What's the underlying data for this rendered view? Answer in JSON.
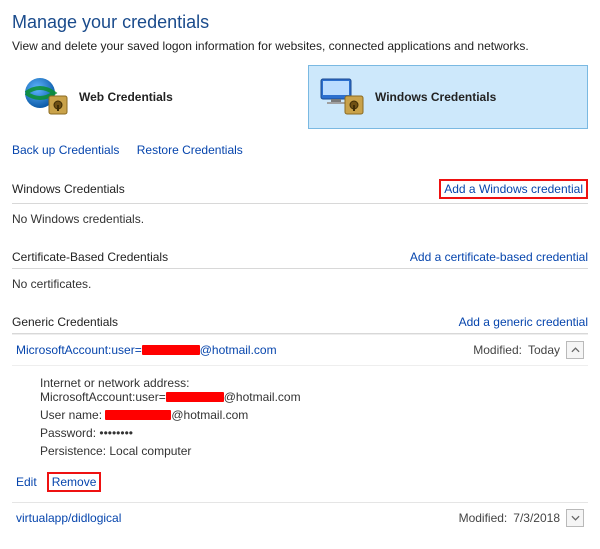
{
  "header": {
    "title": "Manage your credentials",
    "subtitle": "View and delete your saved logon information for websites, connected applications and networks."
  },
  "tiles": {
    "web": {
      "label": "Web Credentials"
    },
    "windows": {
      "label": "Windows Credentials"
    }
  },
  "link_bar": {
    "backup": "Back up Credentials",
    "restore": "Restore Credentials"
  },
  "sections": {
    "windows": {
      "title": "Windows Credentials",
      "add_label": "Add a Windows credential",
      "empty": "No Windows credentials."
    },
    "cert": {
      "title": "Certificate-Based Credentials",
      "add_label": "Add a certificate-based credential",
      "empty": "No certificates."
    },
    "generic": {
      "title": "Generic Credentials",
      "add_label": "Add a generic credential"
    }
  },
  "modified_label": "Modified:",
  "detail_labels": {
    "addr": "Internet or network address:",
    "user": "User name:",
    "pass": "Password:",
    "persist": "Persistence:"
  },
  "entries": {
    "ms": {
      "title_prefix": "MicrosoftAccount:user=",
      "title_suffix": "@hotmail.com",
      "modified": "Today",
      "addr_prefix": "MicrosoftAccount:user=",
      "addr_suffix": "@hotmail.com",
      "user_suffix": "@hotmail.com",
      "password_mask": "••••••••",
      "persistence": "Local computer",
      "edit": "Edit",
      "remove": "Remove"
    },
    "vapp": {
      "title": "virtualapp/didlogical",
      "modified": "7/3/2018"
    }
  }
}
